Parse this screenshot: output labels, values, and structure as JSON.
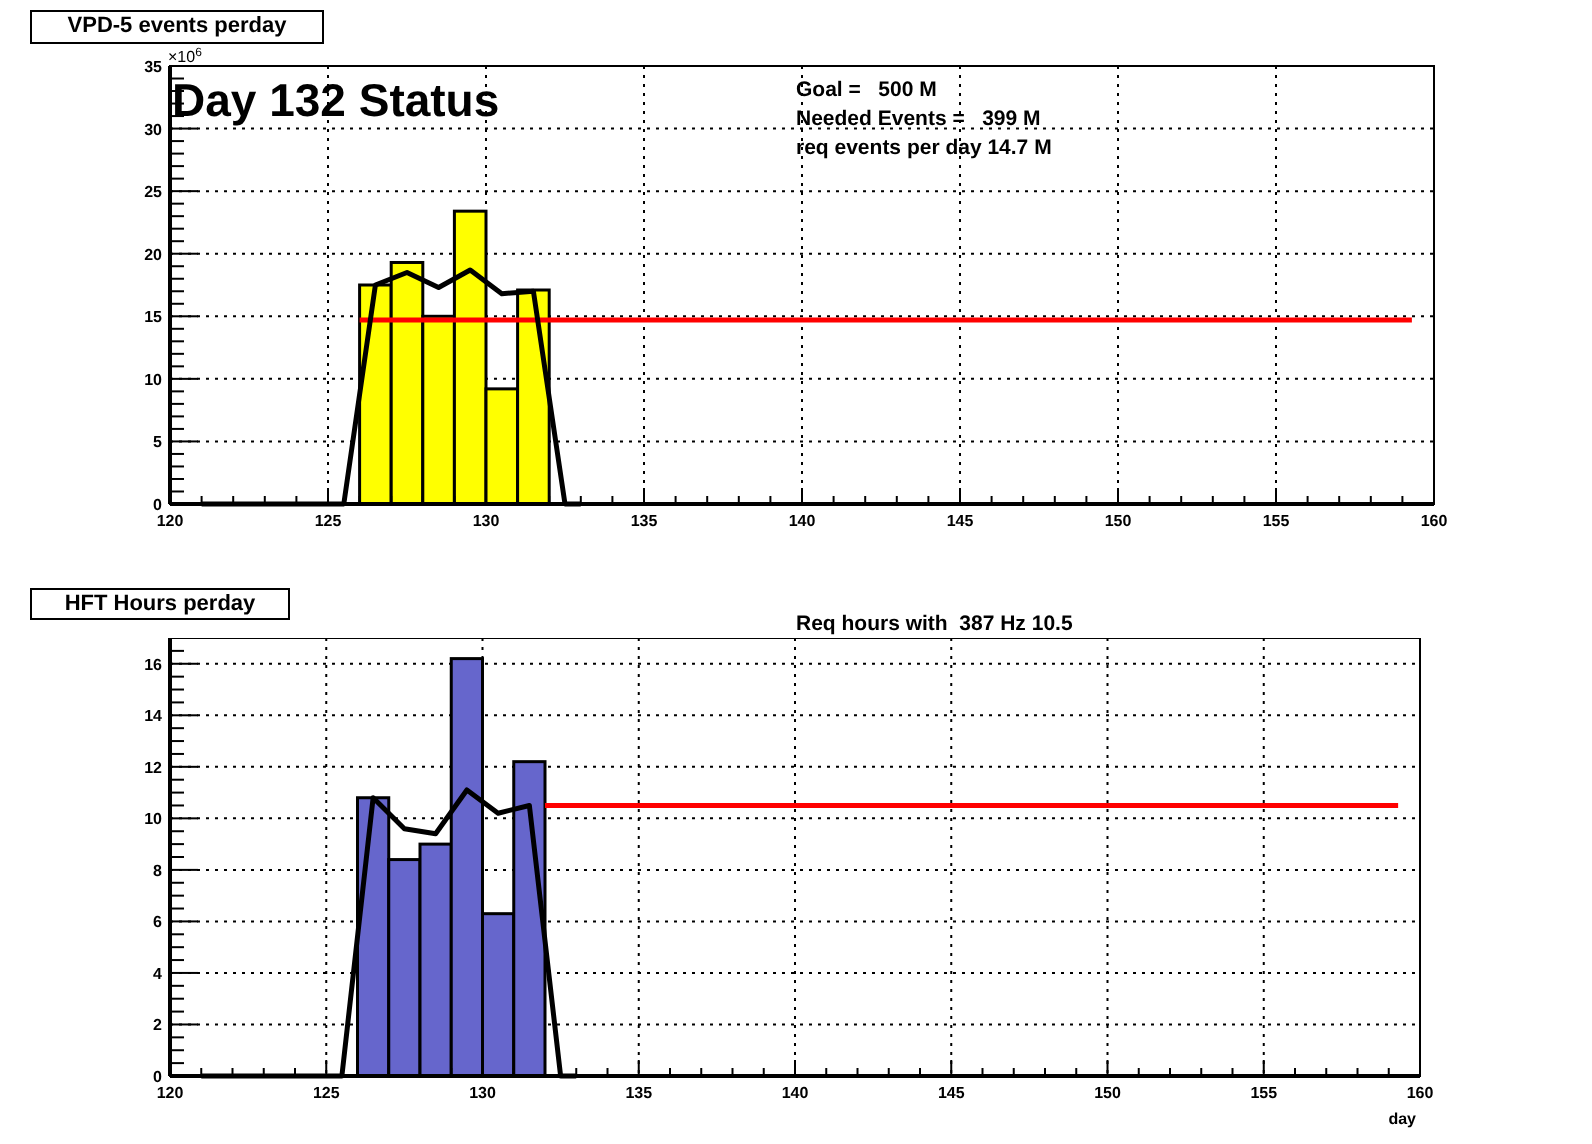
{
  "panels": [
    {
      "title": "VPD-5 events perday",
      "y_multiplier": "×10$^{6}$",
      "heading": "Day 132 Status",
      "notes": [
        "Goal =   500 M",
        "Needed Events =   399 M",
        "req events per day 14.7 M"
      ],
      "chart_data": {
        "type": "bar",
        "xlim": [
          120,
          160
        ],
        "ylim": [
          0,
          35
        ],
        "xticks": [
          120,
          125,
          130,
          135,
          140,
          145,
          150,
          155,
          160
        ],
        "yticks": [
          0,
          5,
          10,
          15,
          20,
          25,
          30,
          35
        ],
        "series": [
          {
            "color": "#ffff00",
            "x": [
              126.5,
              127.5,
              128.5,
              129.5,
              130.5,
              131.5
            ],
            "values": [
              17.5,
              19.3,
              15.0,
              23.4,
              9.2,
              17.1
            ]
          },
          {
            "type": "line",
            "color": "#ff0000",
            "x": [
              126,
              159.3
            ],
            "values": [
              14.7,
              14.7
            ]
          },
          {
            "type": "line",
            "color": "#000000",
            "x": [
              121,
              125.5,
              126.5,
              127.5,
              128.5,
              129.5,
              130.5,
              131.5,
              132.5,
              133
            ],
            "values": [
              0,
              0,
              17.5,
              18.5,
              17.3,
              18.7,
              16.8,
              17.0,
              0,
              0
            ]
          }
        ]
      }
    },
    {
      "title": "HFT Hours perday",
      "subtitle": "Req hours with  387 Hz 10.5",
      "chart_data": {
        "type": "bar",
        "xlabel": "day",
        "xlim": [
          120,
          160
        ],
        "ylim": [
          0,
          17
        ],
        "xticks": [
          120,
          125,
          130,
          135,
          140,
          145,
          150,
          155,
          160
        ],
        "yticks": [
          0,
          2,
          4,
          6,
          8,
          10,
          12,
          14,
          16
        ],
        "series": [
          {
            "color": "#6666cc",
            "x": [
              126.5,
              127.5,
              128.5,
              129.5,
              130.5,
              131.5
            ],
            "values": [
              10.8,
              8.4,
              9.0,
              16.2,
              6.3,
              12.2
            ]
          },
          {
            "type": "line",
            "color": "#ff0000",
            "x": [
              132,
              159.3
            ],
            "values": [
              10.5,
              10.5
            ]
          },
          {
            "type": "line",
            "color": "#000000",
            "x": [
              121,
              125.5,
              126.5,
              127.5,
              128.5,
              129.5,
              130.5,
              131.5,
              132.5,
              133
            ],
            "values": [
              0,
              0,
              10.8,
              9.6,
              9.4,
              11.1,
              10.2,
              10.5,
              0,
              0
            ]
          }
        ]
      }
    }
  ]
}
